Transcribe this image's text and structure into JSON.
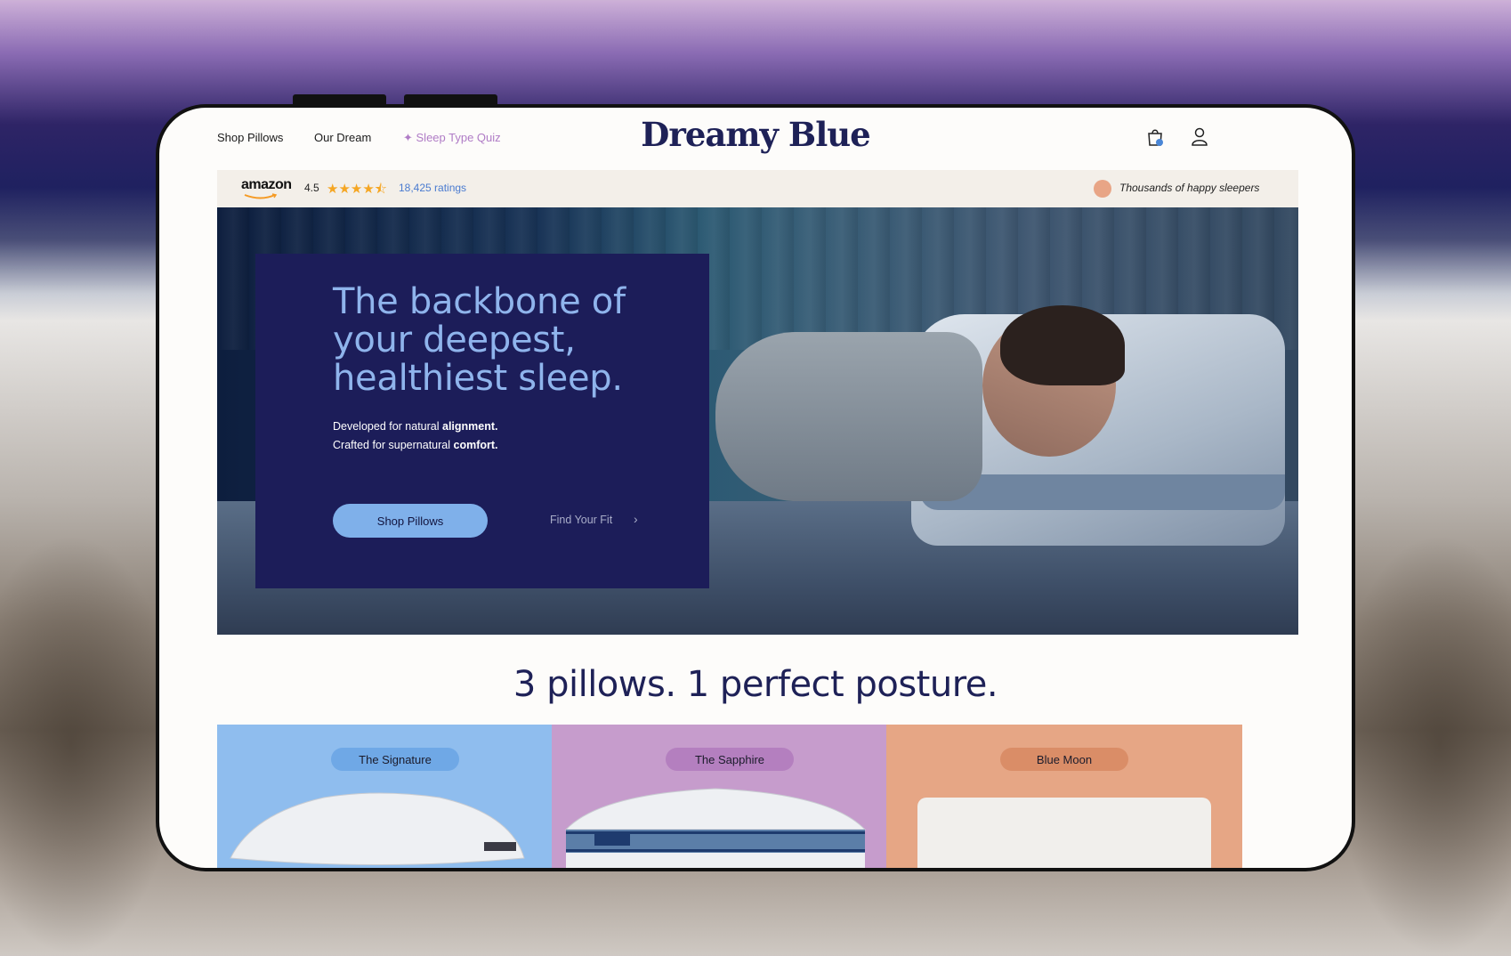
{
  "nav": {
    "shop_pillows": "Shop Pillows",
    "our_dream": "Our Dream",
    "quiz": "✦ Sleep Type Quiz"
  },
  "logo": "Dreamy Blue",
  "cart_count": "1",
  "ratings": {
    "brand": "amazon",
    "score": "4.5",
    "stars": "★★★★⯪",
    "count": "18,425 ratings",
    "tagline": "Thousands of happy sleepers"
  },
  "hero": {
    "title": "The backbone of your deepest, healthiest sleep.",
    "line1_prefix": "Developed for natural ",
    "line1_bold": "alignment.",
    "line2_prefix": "Crafted for supernatural ",
    "line2_bold": "comfort.",
    "cta_primary": "Shop Pillows",
    "cta_secondary": "Find Your Fit"
  },
  "section_title": "3 pillows. 1 perfect posture.",
  "products": [
    {
      "name": "The Signature",
      "bg": "#8fbdee",
      "badge": "#6fa8e6"
    },
    {
      "name": "The Sapphire",
      "bg": "#c69ccc",
      "badge": "#b47fbf"
    },
    {
      "name": "Blue Moon",
      "bg": "#e6a685",
      "badge": "#da8d67"
    }
  ],
  "colors": {
    "brand_navy": "#1e2157",
    "hero_panel": "#1c1d59",
    "accent_blue": "#7fb0ea"
  }
}
